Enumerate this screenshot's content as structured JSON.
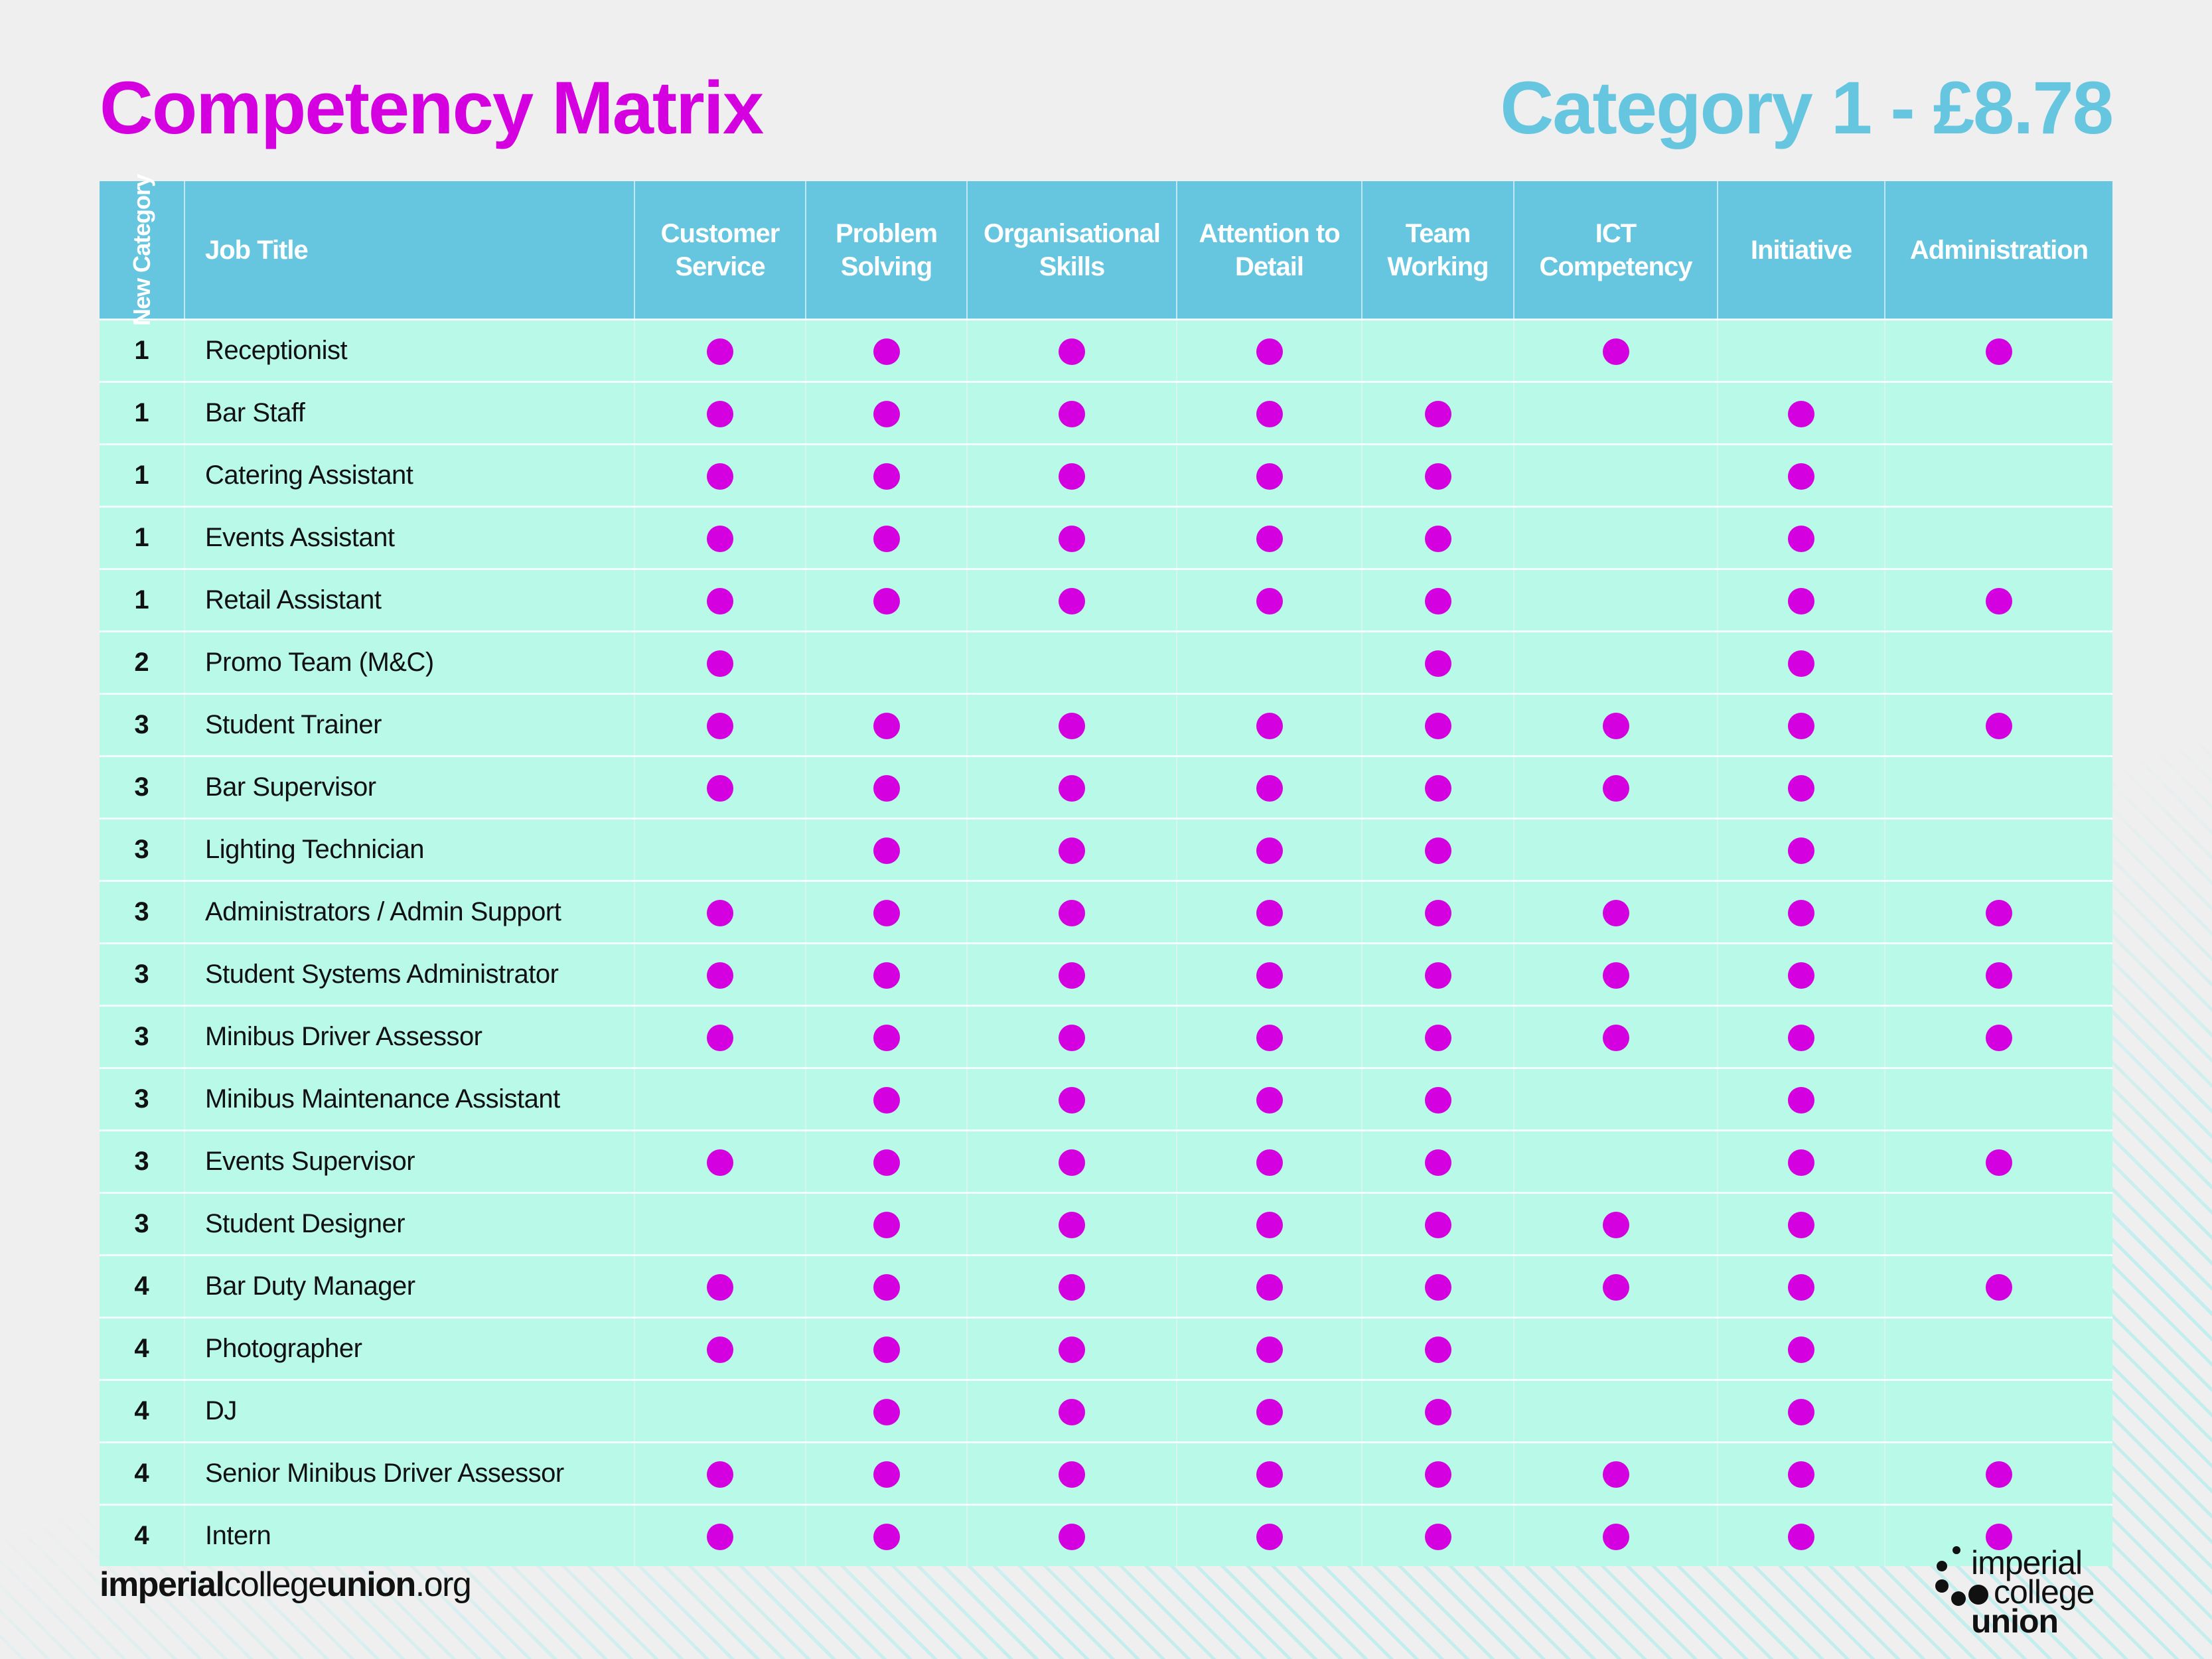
{
  "page": {
    "title": "Competency Matrix",
    "subtitle": "Category 1 - £8.78"
  },
  "colors": {
    "title": "#D400E0",
    "subtitle": "#66C6E0",
    "header_bg": "#66C6E0",
    "row_bg": "#B8F9E8",
    "dot": "#D400E0",
    "hatch": "#C4EEEE",
    "background": "#EFEFEF"
  },
  "table": {
    "headers": {
      "category": "New Category",
      "job_title": "Job Title",
      "competencies": [
        "Customer Service",
        "Problem Solving",
        "Organisational Skills",
        "Attention to Detail",
        "Team Working",
        "ICT Competency",
        "Initiative",
        "Administration"
      ]
    },
    "rows": [
      {
        "category": "1",
        "job_title": "Receptionist",
        "marks": [
          true,
          true,
          true,
          true,
          false,
          true,
          false,
          true
        ]
      },
      {
        "category": "1",
        "job_title": "Bar Staff",
        "marks": [
          true,
          true,
          true,
          true,
          true,
          false,
          true,
          false
        ]
      },
      {
        "category": "1",
        "job_title": "Catering Assistant",
        "marks": [
          true,
          true,
          true,
          true,
          true,
          false,
          true,
          false
        ]
      },
      {
        "category": "1",
        "job_title": "Events Assistant",
        "marks": [
          true,
          true,
          true,
          true,
          true,
          false,
          true,
          false
        ]
      },
      {
        "category": "1",
        "job_title": "Retail Assistant",
        "marks": [
          true,
          true,
          true,
          true,
          true,
          false,
          true,
          true
        ]
      },
      {
        "category": "2",
        "job_title": "Promo Team (M&C)",
        "marks": [
          true,
          false,
          false,
          false,
          true,
          false,
          true,
          false
        ]
      },
      {
        "category": "3",
        "job_title": "Student Trainer",
        "marks": [
          true,
          true,
          true,
          true,
          true,
          true,
          true,
          true
        ]
      },
      {
        "category": "3",
        "job_title": "Bar Supervisor",
        "marks": [
          true,
          true,
          true,
          true,
          true,
          true,
          true,
          false
        ]
      },
      {
        "category": "3",
        "job_title": "Lighting Technician",
        "marks": [
          false,
          true,
          true,
          true,
          true,
          false,
          true,
          false
        ]
      },
      {
        "category": "3",
        "job_title": "Administrators / Admin Support",
        "marks": [
          true,
          true,
          true,
          true,
          true,
          true,
          true,
          true
        ]
      },
      {
        "category": "3",
        "job_title": "Student Systems Administrator",
        "marks": [
          true,
          true,
          true,
          true,
          true,
          true,
          true,
          true
        ]
      },
      {
        "category": "3",
        "job_title": "Minibus Driver Assessor",
        "marks": [
          true,
          true,
          true,
          true,
          true,
          true,
          true,
          true
        ]
      },
      {
        "category": "3",
        "job_title": "Minibus Maintenance Assistant",
        "marks": [
          false,
          true,
          true,
          true,
          true,
          false,
          true,
          false
        ]
      },
      {
        "category": "3",
        "job_title": "Events Supervisor",
        "marks": [
          true,
          true,
          true,
          true,
          true,
          false,
          true,
          true
        ]
      },
      {
        "category": "3",
        "job_title": "Student Designer",
        "marks": [
          false,
          true,
          true,
          true,
          true,
          true,
          true,
          false
        ]
      },
      {
        "category": "4",
        "job_title": "Bar Duty Manager",
        "marks": [
          true,
          true,
          true,
          true,
          true,
          true,
          true,
          true
        ]
      },
      {
        "category": "4",
        "job_title": "Photographer",
        "marks": [
          true,
          true,
          true,
          true,
          true,
          false,
          true,
          false
        ]
      },
      {
        "category": "4",
        "job_title": "DJ",
        "marks": [
          false,
          true,
          true,
          true,
          true,
          false,
          true,
          false
        ]
      },
      {
        "category": "4",
        "job_title": "Senior Minibus Driver Assessor",
        "marks": [
          true,
          true,
          true,
          true,
          true,
          true,
          true,
          true
        ]
      },
      {
        "category": "4",
        "job_title": "Intern",
        "marks": [
          true,
          true,
          true,
          true,
          true,
          true,
          true,
          true
        ]
      }
    ]
  },
  "footer": {
    "url_parts": [
      {
        "text": "imperial",
        "bold": true
      },
      {
        "text": "college",
        "bold": false
      },
      {
        "text": "union",
        "bold": true
      },
      {
        "text": ".org",
        "bold": false
      }
    ],
    "logo": {
      "icon": "dots-logo-icon",
      "line1": "imperial",
      "line2": "college",
      "line3": "union"
    }
  }
}
